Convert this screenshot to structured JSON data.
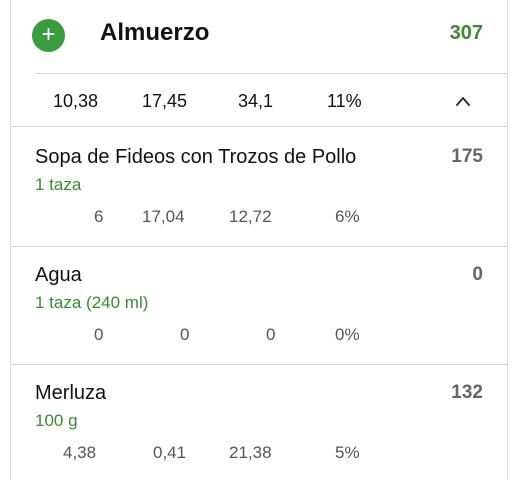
{
  "meal": {
    "title": "Almuerzo",
    "total_kcal": "307",
    "add_label": "+"
  },
  "summary": {
    "values": [
      "10,38",
      "17,45",
      "34,1",
      "11%"
    ],
    "collapse_icon": "chevron-up-icon"
  },
  "items": [
    {
      "name": "Sopa de Fideos con Trozos de Pollo",
      "kcal": "175",
      "portion": "1 taza",
      "nutrients": [
        "6",
        "17,04",
        "12,72",
        "6%"
      ]
    },
    {
      "name": "Agua",
      "kcal": "0",
      "portion": "1 taza (240 ml)",
      "nutrients": [
        "0",
        "0",
        "0",
        "0%"
      ]
    },
    {
      "name": "Merluza",
      "kcal": "132",
      "portion": "100 g",
      "nutrients": [
        "4,38",
        "0,41",
        "21,38",
        "5%"
      ]
    }
  ],
  "colors": {
    "accent_green": "#3a9b3f",
    "portion_green": "#3a8b2f",
    "muted_text": "#666666"
  }
}
